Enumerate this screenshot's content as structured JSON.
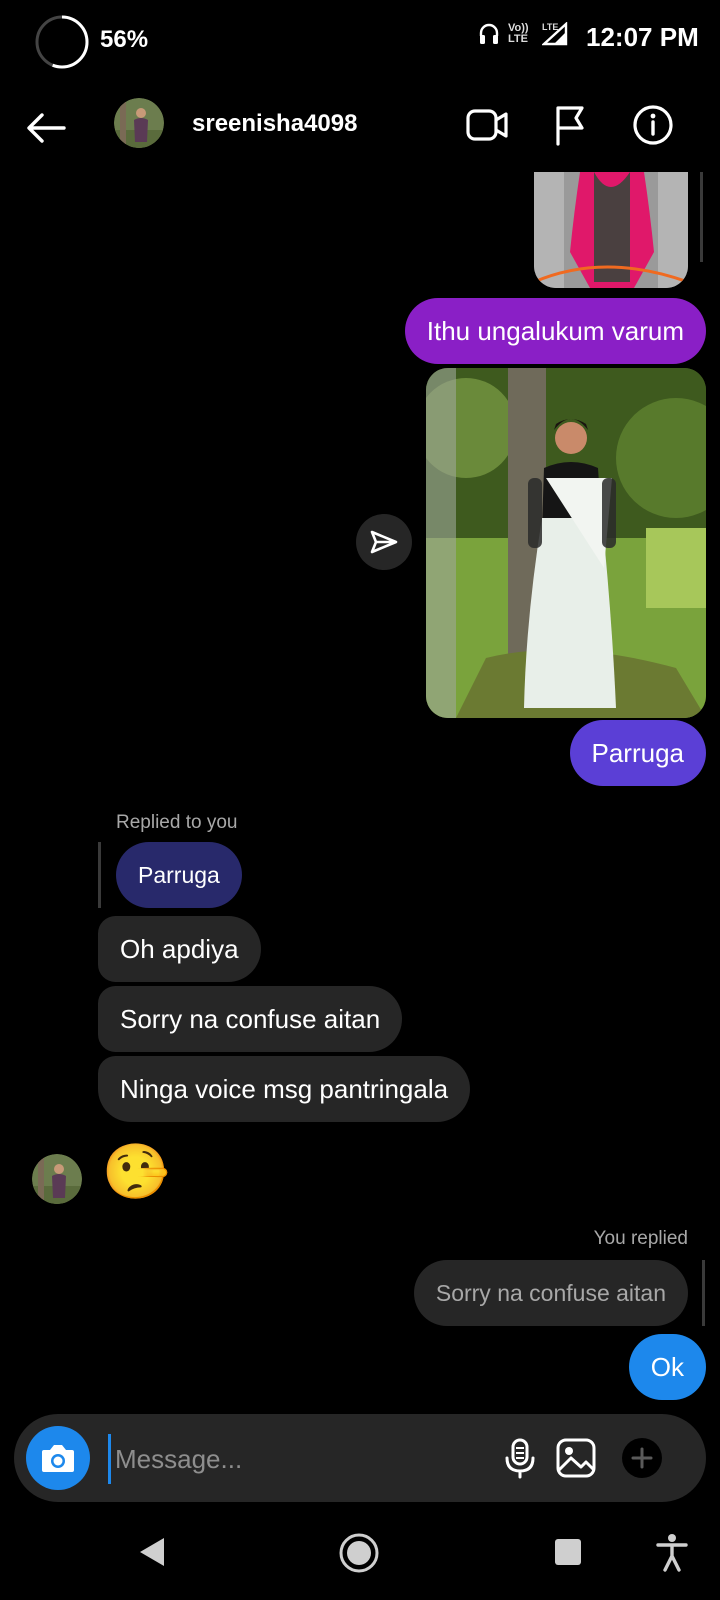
{
  "status_bar": {
    "battery": "56%",
    "network_volte": "Vo)) LTE",
    "network_lte": "LTE",
    "time": "12:07 PM",
    "icons": [
      "headset-icon",
      "volte-icon",
      "signal-icon"
    ]
  },
  "header": {
    "username": "sreenisha4098",
    "icons": [
      "back-arrow-icon",
      "video-call-icon",
      "flag-icon",
      "info-icon"
    ]
  },
  "messages": {
    "sent_1": "Ithu ungalukum varum",
    "sent_2": "Parruga",
    "replied_label": "Replied to you",
    "quoted": "Parruga",
    "recv_1": "Oh apdiya",
    "recv_2": "Sorry na confuse aitan",
    "recv_3": "Ninga voice msg pantringala",
    "recv_emoji": "🤥",
    "you_replied_label": "You replied",
    "quoted_own": "Sorry na confuse aitan",
    "sent_3": "Ok"
  },
  "composer": {
    "placeholder": "Message..."
  },
  "colors": {
    "sent_purple": "#8a1fc6",
    "sent_indigo": "#5b3fd6",
    "sent_blue": "#1d88ec",
    "received_gray": "#262626",
    "quote_navy": "#28296b"
  }
}
